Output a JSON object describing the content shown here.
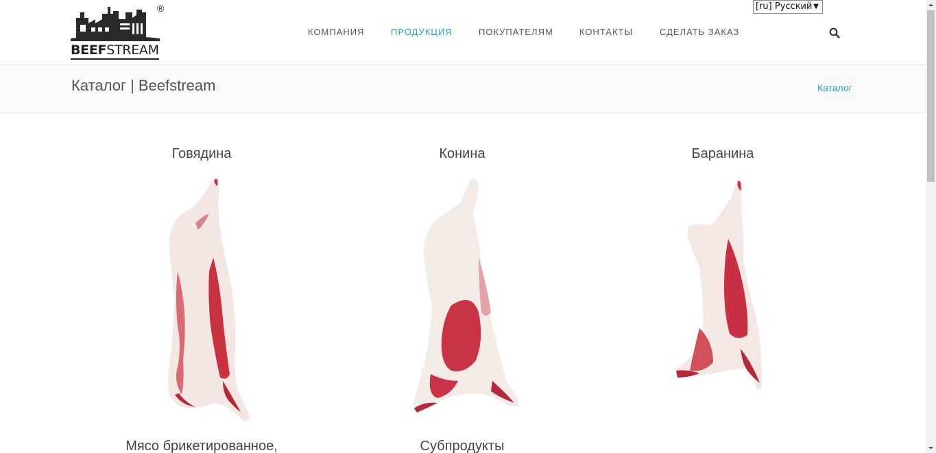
{
  "header": {
    "logo_text_bold": "BEEF",
    "logo_text_thin": "STREAM",
    "logo_reg": "®",
    "nav": [
      {
        "label": "КОМПАНИЯ",
        "active": false
      },
      {
        "label": "ПРОДУКЦИЯ",
        "active": true
      },
      {
        "label": "ПОКУПАТЕЛЯМ",
        "active": false
      },
      {
        "label": "КОНТАКТЫ",
        "active": false
      },
      {
        "label": "СДЕЛАТЬ ЗАКАЗ",
        "active": false
      }
    ],
    "search_icon": "search-icon",
    "language_selected": "[ru] Русский"
  },
  "titlebar": {
    "title": "Каталог | Beefstream",
    "breadcrumb": "Каталог"
  },
  "catalog": {
    "items": [
      {
        "title": "Говядина",
        "image": "beef-carcass"
      },
      {
        "title": "Конина",
        "image": "horse-carcass"
      },
      {
        "title": "Баранина",
        "image": "lamb-carcass"
      },
      {
        "title": "Мясо брикетированное,",
        "image": ""
      },
      {
        "title": "Субпродукты",
        "image": ""
      }
    ]
  },
  "colors": {
    "accent": "#2d9bc9",
    "nav_text": "#555555",
    "title_bar_bg": "#f9f9f9",
    "meat_red": "#c0293f",
    "fat_white": "#f4e4e0"
  }
}
